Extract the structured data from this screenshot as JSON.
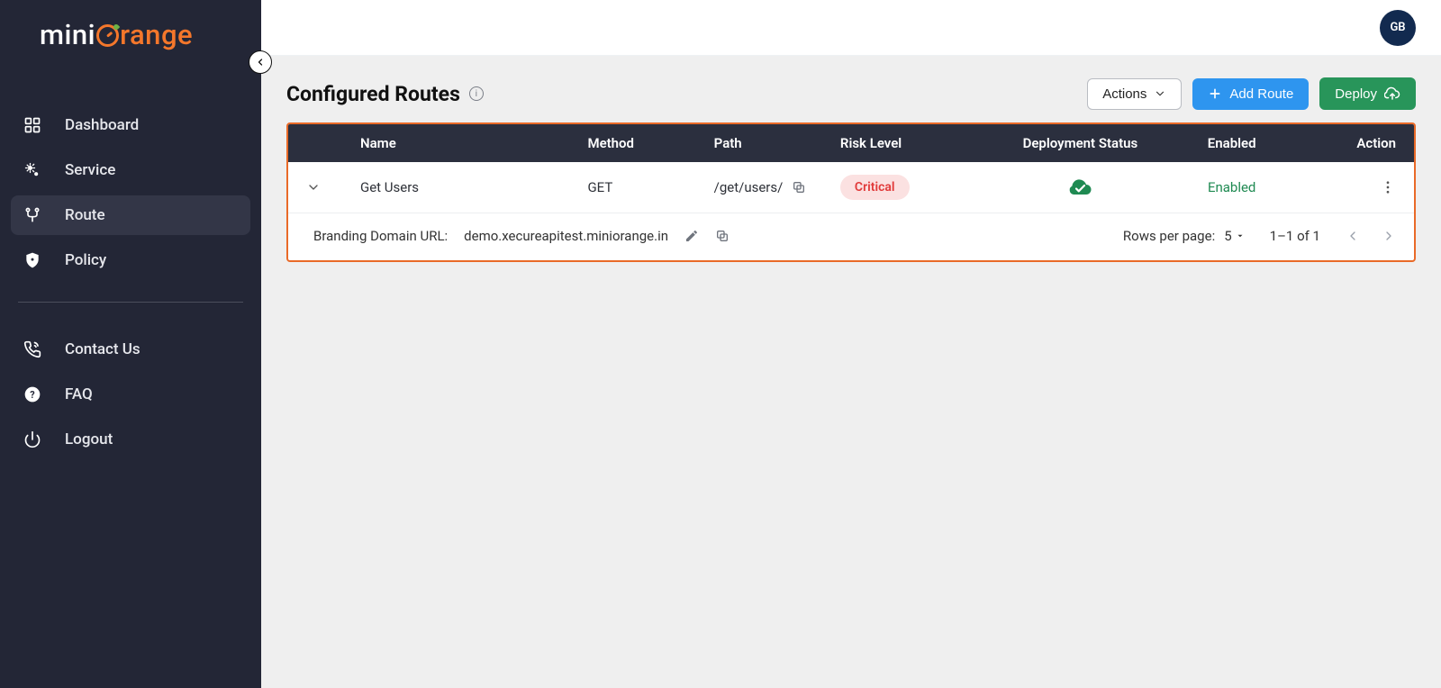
{
  "brand": {
    "part1": "mini",
    "part2": "range"
  },
  "user": {
    "initials": "GB"
  },
  "sidebar": {
    "items": [
      {
        "label": "Dashboard"
      },
      {
        "label": "Service"
      },
      {
        "label": "Route"
      },
      {
        "label": "Policy"
      }
    ],
    "footerItems": [
      {
        "label": "Contact Us"
      },
      {
        "label": "FAQ"
      },
      {
        "label": "Logout"
      }
    ]
  },
  "page": {
    "title": "Configured Routes",
    "actionsLabel": "Actions",
    "addRouteLabel": "Add Route",
    "deployLabel": "Deploy"
  },
  "table": {
    "headers": {
      "name": "Name",
      "method": "Method",
      "path": "Path",
      "risk": "Risk Level",
      "deployment": "Deployment Status",
      "enabled": "Enabled",
      "action": "Action"
    },
    "rows": [
      {
        "name": "Get Users",
        "method": "GET",
        "path": "/get/users/",
        "risk": "Critical",
        "enabled": "Enabled"
      }
    ],
    "footer": {
      "brandingLabel": "Branding Domain URL:",
      "brandingUrl": "demo.xecureapitest.miniorange.in",
      "rowsPerPageLabel": "Rows per page:",
      "rowsPerPageValue": "5",
      "rangeText": "1–1 of 1"
    }
  }
}
